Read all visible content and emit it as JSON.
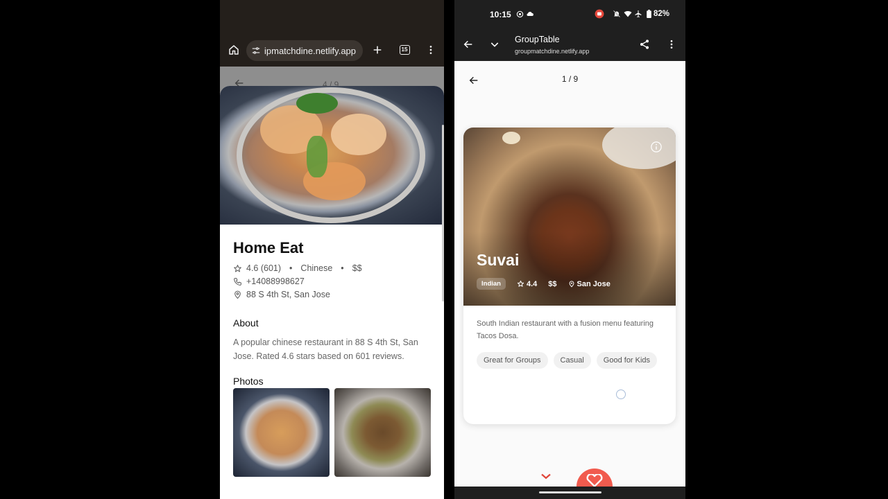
{
  "left_browser": {
    "url": "ipmatchdine.netlify.app",
    "tab_count": "15"
  },
  "left_background_page": {
    "counter": "4 / 9"
  },
  "left_detail": {
    "name": "Home Eat",
    "rating": "4.6 (601)",
    "cuisine": "Chinese",
    "price": "$$",
    "phone": "+14088998627",
    "address": "88 S 4th St, San Jose",
    "about_heading": "About",
    "about_text": "A popular chinese restaurant in 88 S 4th St, San Jose. Rated 4.6 stars based on 601 reviews.",
    "photos_heading": "Photos"
  },
  "right_status": {
    "time": "10:15",
    "battery": "82%"
  },
  "right_appbar": {
    "title": "GroupTable",
    "url": "groupmatchdine.netlify.app"
  },
  "right_page": {
    "counter": "1 / 9"
  },
  "card": {
    "name": "Suvai",
    "cuisine": "Indian",
    "rating": "4.4",
    "price": "$$",
    "location": "San Jose",
    "description": "South Indian restaurant with a fusion menu featuring Tacos Dosa.",
    "tags": [
      "Great for Groups",
      "Casual",
      "Good for Kids"
    ]
  },
  "colors": {
    "like_button": "#f15b4e",
    "dislike_icon": "#e0463a",
    "left_chrome": "#241f1b",
    "right_chrome": "#1f1f1f"
  },
  "icons": {
    "home": "home-icon",
    "tune": "tune-icon",
    "add": "plus-icon",
    "tabs": "tab-switcher-icon",
    "menu": "more-vert-icon",
    "back": "arrow-back-icon",
    "star": "star-icon",
    "phone": "phone-icon",
    "location": "location-pin-icon",
    "info": "info-icon",
    "share": "share-icon",
    "chevron": "chevron-down-icon",
    "heart": "heart-icon",
    "close": "close-icon"
  }
}
